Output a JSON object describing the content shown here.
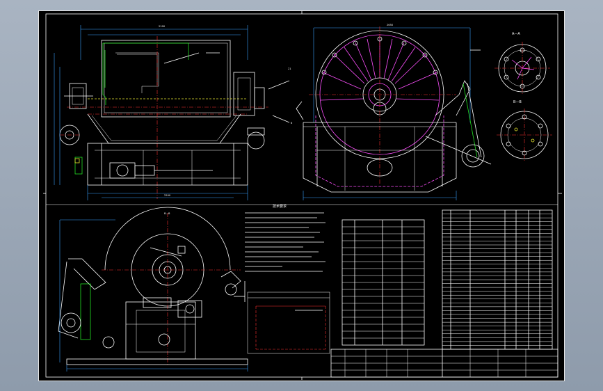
{
  "drawing": {
    "notes_title": "技术要求",
    "note_lines": 13,
    "detail_box_title": "",
    "params_table_rows": 18,
    "bom_rows": 36,
    "title_block_rows": 4
  },
  "colors": {
    "background": "#000000",
    "frame": "#ffffff",
    "dimension": "#3aa0ff",
    "centerline": "#ff3030",
    "hidden": "#e8e830",
    "pipe": "#22e022",
    "disc": "#ff50ff",
    "aux": "#20e0e0"
  }
}
